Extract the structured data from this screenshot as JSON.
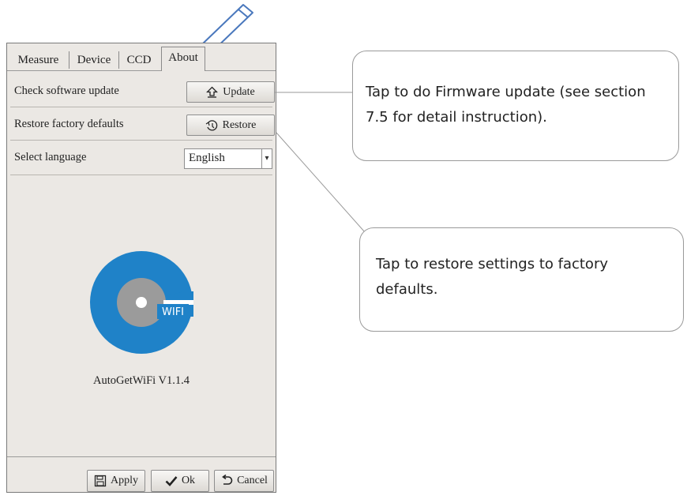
{
  "tabs": [
    {
      "label": "Measure"
    },
    {
      "label": "Device"
    },
    {
      "label": "CCD"
    },
    {
      "label": "About",
      "active": true
    }
  ],
  "rows": {
    "update": {
      "label": "Check software update",
      "button": "Update",
      "icon": "home-up-arrow-icon"
    },
    "restore": {
      "label": "Restore factory defaults",
      "button": "Restore",
      "icon": "restore-clock-icon"
    },
    "language": {
      "label": "Select language",
      "value": "English"
    }
  },
  "logo": {
    "text": "WIFI",
    "colors": {
      "ring": "#1f82c8",
      "core": "#9b9b9b",
      "dot": "#ffffff"
    }
  },
  "version": "AutoGetWiFi V1.1.4",
  "footer": {
    "apply": {
      "label": "Apply",
      "icon": "save-disk-icon"
    },
    "ok": {
      "label": "Ok",
      "icon": "checkmark-icon"
    },
    "cancel": {
      "label": "Cancel",
      "icon": "undo-arrow-icon"
    }
  },
  "callouts": {
    "update": "Tap to do Firmware update (see section 7.5 for detail instruction).",
    "restore": "Tap to restore settings to factory defaults."
  },
  "colors": {
    "panel_bg": "#ebe8e4",
    "accent_pen": "#4a7bbf"
  }
}
